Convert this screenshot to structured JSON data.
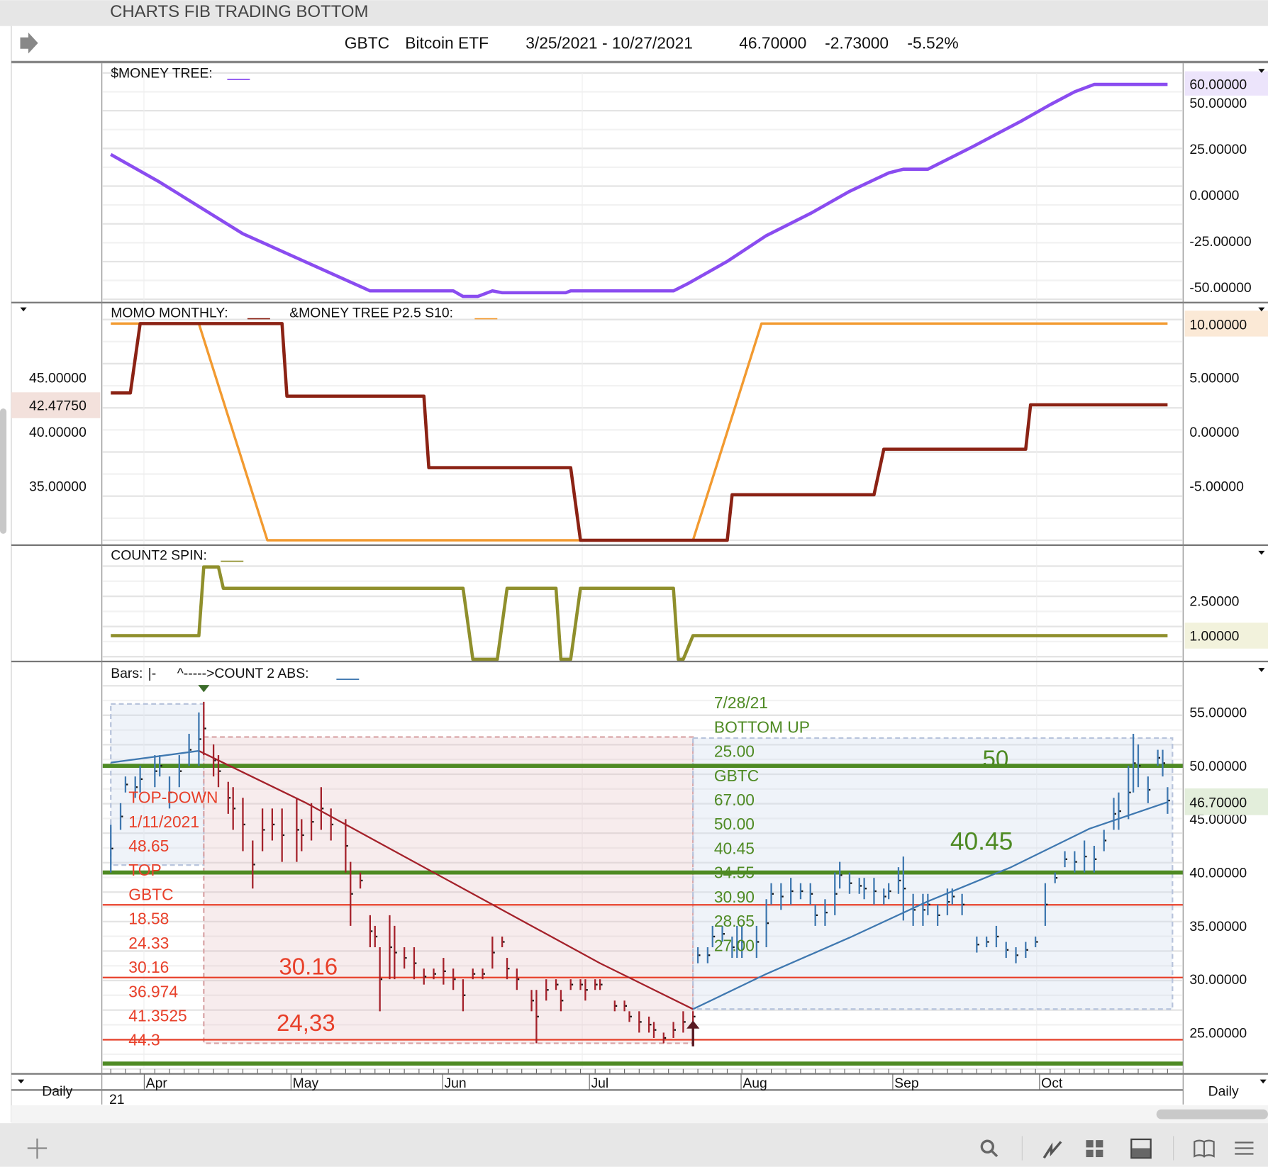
{
  "window_title": "CHARTS FIB TRADING BOTTOM",
  "header": {
    "symbol": "GBTC",
    "name": "Bitcoin ETF",
    "range": "3/25/2021 - 10/27/2021",
    "last": "46.70000",
    "change": "-2.73000",
    "pct": "-5.52%"
  },
  "colors": {
    "purple": "#8a4cf0",
    "momo": "#8b2214",
    "orange": "#f29a30",
    "spin": "#8f8f2c",
    "green_line": "#4e8a23",
    "red_line": "#e8402a",
    "bar_up": "#3f78b0",
    "bar_down": "#a4212a"
  },
  "panels": {
    "money_tree": {
      "label": "$MONEY TREE:",
      "ticks": [
        "50.00000",
        "25.00000",
        "0.00000",
        "-25.00000",
        "-50.00000"
      ],
      "current": "60.00000"
    },
    "momo": {
      "label": "MOMO MONTHLY:",
      "label2": "&MONEY TREE P2.5 S10:",
      "ticks": [
        "5.00000",
        "0.00000",
        "-5.00000"
      ],
      "current": "10.00000",
      "left_ticks": [
        "45.00000",
        "40.00000",
        "35.00000"
      ],
      "left_current": "42.47750"
    },
    "spin": {
      "label": "COUNT2 SPIN:",
      "ticks": [
        "2.50000"
      ],
      "current": "1.00000"
    },
    "price": {
      "label": "Bars:",
      "label_sym": "|-",
      "label2": "^----->COUNT 2 ABS:",
      "ticks": [
        "55.00000",
        "50.00000",
        "45.00000",
        "40.00000",
        "35.00000",
        "30.00000",
        "25.00000"
      ],
      "current": "46.70000"
    }
  },
  "annotations": {
    "left": [
      "TOP-DOWN",
      "1/11/2021",
      "48.65",
      "TOP",
      "GBTC",
      "18.58",
      "24.33",
      "30.16",
      "36.974",
      "41.3525",
      "44.3"
    ],
    "right": [
      "7/28/21",
      "BOTTOM UP",
      "25.00",
      "GBTC",
      "67.00",
      "50.00",
      "40.45",
      "34.55",
      "30.90",
      "28.65",
      "27.00"
    ],
    "big": {
      "a": "30.16",
      "b": "24,33",
      "c": "50",
      "d": "40.45"
    }
  },
  "x_axis": {
    "months": [
      "Apr",
      "May",
      "Jun",
      "Jul",
      "Aug",
      "Sep",
      "Oct"
    ],
    "year": "21",
    "period_left": "Daily",
    "period_right": "Daily"
  },
  "toolbar": {
    "icons": [
      "add-icon",
      "search-icon",
      "chart-line-icon",
      "grid-icon",
      "panel-icon",
      "book-icon",
      "menu-icon"
    ]
  },
  "chart_data": {
    "type": "ohlc",
    "x_unit": "calendar days since 3/25/2021",
    "bars": [
      [
        0,
        44.5,
        40
      ],
      [
        2,
        46.5,
        44
      ],
      [
        3,
        49,
        47.5
      ],
      [
        5,
        49,
        47
      ],
      [
        6,
        50,
        47.5
      ],
      [
        9,
        51,
        48
      ],
      [
        10,
        51,
        49
      ],
      [
        12,
        49,
        46
      ],
      [
        14,
        51,
        48
      ],
      [
        16,
        53,
        50
      ],
      [
        18,
        55,
        50
      ],
      [
        19,
        56,
        51
      ],
      [
        21,
        52,
        49
      ],
      [
        22,
        51,
        48
      ],
      [
        24,
        48.5,
        45.5
      ],
      [
        25,
        48,
        44
      ],
      [
        27,
        47,
        42
      ],
      [
        29,
        43,
        38.5
      ],
      [
        31,
        46,
        42
      ],
      [
        33,
        46,
        43
      ],
      [
        35,
        46,
        41
      ],
      [
        38,
        47,
        41
      ],
      [
        39,
        45,
        42
      ],
      [
        41,
        46.5,
        43
      ],
      [
        43,
        48,
        44
      ],
      [
        45,
        46,
        43
      ],
      [
        48,
        45,
        40
      ],
      [
        49,
        41,
        35
      ],
      [
        51,
        40,
        38.5
      ],
      [
        53,
        36,
        33
      ],
      [
        54,
        35,
        33
      ],
      [
        55,
        33,
        27
      ],
      [
        57,
        36,
        30
      ],
      [
        58,
        35,
        30
      ],
      [
        60,
        33,
        31
      ],
      [
        62,
        33,
        30
      ],
      [
        64,
        31,
        29.5
      ],
      [
        66,
        31,
        30
      ],
      [
        68,
        32,
        29.5
      ],
      [
        70,
        31,
        29
      ],
      [
        72,
        30,
        27
      ],
      [
        74,
        31,
        30
      ],
      [
        76,
        31,
        30
      ],
      [
        78,
        34,
        31
      ],
      [
        80,
        34,
        33
      ],
      [
        81,
        32,
        30
      ],
      [
        83,
        31,
        29
      ],
      [
        86,
        29,
        27
      ],
      [
        87,
        29,
        24
      ],
      [
        89,
        30,
        28
      ],
      [
        91,
        30,
        29
      ],
      [
        92,
        29,
        27
      ],
      [
        94,
        30,
        29
      ],
      [
        96,
        30,
        29
      ],
      [
        97,
        30,
        28
      ],
      [
        99,
        30,
        29
      ],
      [
        100,
        30,
        29
      ],
      [
        103,
        28,
        27
      ],
      [
        105,
        28,
        27
      ],
      [
        106,
        27,
        26
      ],
      [
        108,
        27,
        25
      ],
      [
        110,
        26.5,
        25
      ],
      [
        111,
        26,
        24.5
      ],
      [
        113,
        25,
        24
      ],
      [
        115,
        26,
        24.5
      ],
      [
        117,
        27,
        25
      ],
      [
        119,
        27,
        26
      ],
      [
        120,
        33,
        31.5
      ],
      [
        122,
        33,
        31.5
      ],
      [
        123,
        35,
        33
      ],
      [
        125,
        35,
        33.5
      ],
      [
        127,
        34,
        32
      ],
      [
        128,
        35,
        32
      ],
      [
        129,
        35,
        32
      ],
      [
        132,
        35,
        32
      ],
      [
        134,
        37.5,
        33
      ],
      [
        135,
        39,
        37
      ],
      [
        137,
        39,
        36.5
      ],
      [
        139,
        39.5,
        37
      ],
      [
        141,
        39,
        37.5
      ],
      [
        143,
        39,
        37
      ],
      [
        144,
        37,
        35
      ],
      [
        146,
        37.5,
        35
      ],
      [
        148,
        40,
        36
      ],
      [
        149,
        41,
        38.5
      ],
      [
        151,
        40,
        38
      ],
      [
        153,
        39.5,
        38
      ],
      [
        154,
        39.5,
        37.5
      ],
      [
        156,
        39.5,
        37
      ],
      [
        158,
        38.5,
        37
      ],
      [
        159,
        39,
        37.5
      ],
      [
        161,
        40.5,
        38
      ],
      [
        162,
        41.5,
        35.5
      ],
      [
        164,
        38,
        35
      ],
      [
        166,
        38,
        35
      ],
      [
        167,
        38,
        36
      ],
      [
        169,
        37,
        35
      ],
      [
        171,
        38.5,
        36
      ],
      [
        172,
        38.5,
        37
      ],
      [
        174,
        38,
        36
      ],
      [
        177,
        34,
        32.5
      ],
      [
        179,
        34,
        33
      ],
      [
        181,
        35,
        33
      ],
      [
        183,
        33.5,
        32
      ],
      [
        185,
        33,
        31.5
      ],
      [
        187,
        33.5,
        32
      ],
      [
        189,
        34,
        33
      ],
      [
        191,
        39,
        35
      ],
      [
        193,
        40,
        39
      ],
      [
        195,
        42,
        40.5
      ],
      [
        197,
        42,
        40
      ],
      [
        199,
        43,
        40
      ],
      [
        201,
        42.5,
        40
      ],
      [
        203,
        44,
        42
      ],
      [
        205,
        47,
        44
      ],
      [
        206,
        47.5,
        44
      ],
      [
        208,
        50,
        45
      ],
      [
        209,
        53,
        47.5
      ],
      [
        210,
        52,
        48
      ],
      [
        212,
        49,
        46.5
      ],
      [
        214,
        51.5,
        50
      ],
      [
        215,
        51.5,
        49
      ],
      [
        216,
        48,
        45.5
      ]
    ],
    "moving_average": [
      [
        0,
        50.3
      ],
      [
        18,
        51.4
      ],
      [
        40,
        46.5
      ],
      [
        60,
        41.5
      ],
      [
        80,
        36.5
      ],
      [
        100,
        31.5
      ],
      [
        119,
        27.2
      ],
      [
        134,
        30.5
      ],
      [
        151,
        33.9
      ],
      [
        167,
        37.3
      ],
      [
        184,
        40.5
      ],
      [
        200,
        44.1
      ],
      [
        216,
        46.6
      ]
    ],
    "money_tree": [
      [
        0,
        22
      ],
      [
        10,
        7
      ],
      [
        27,
        -21
      ],
      [
        53,
        -52
      ],
      [
        70,
        -52
      ],
      [
        72,
        -55
      ],
      [
        75,
        -55
      ],
      [
        78,
        -52
      ],
      [
        80,
        -53
      ],
      [
        93,
        -53
      ],
      [
        94,
        -52
      ],
      [
        115,
        -52
      ],
      [
        118,
        -48
      ],
      [
        126,
        -36
      ],
      [
        134,
        -22
      ],
      [
        143,
        -10
      ],
      [
        151,
        2
      ],
      [
        159,
        12
      ],
      [
        162,
        14
      ],
      [
        167,
        14
      ],
      [
        176,
        26
      ],
      [
        181,
        33
      ],
      [
        186,
        40
      ],
      [
        192,
        49
      ],
      [
        197,
        56
      ],
      [
        201,
        60
      ],
      [
        216,
        60
      ]
    ],
    "momo_monthly": [
      [
        0,
        3.6
      ],
      [
        4,
        3.6
      ],
      [
        6,
        10
      ],
      [
        35,
        10
      ],
      [
        36,
        3.3
      ],
      [
        64,
        3.3
      ],
      [
        65,
        -3.3
      ],
      [
        94,
        -3.3
      ],
      [
        96,
        -10
      ],
      [
        126,
        -10
      ],
      [
        127,
        -5.8
      ],
      [
        156,
        -5.8
      ],
      [
        158,
        -1.6
      ],
      [
        187,
        -1.6
      ],
      [
        188,
        2.5
      ],
      [
        216,
        2.5
      ]
    ],
    "money_tree_p25": [
      [
        0,
        10
      ],
      [
        18,
        10
      ],
      [
        32,
        -10
      ],
      [
        119,
        -10
      ],
      [
        133,
        10
      ],
      [
        216,
        10
      ]
    ],
    "count2_spin": [
      [
        0,
        1
      ],
      [
        18,
        1
      ],
      [
        19,
        3.9
      ],
      [
        22,
        3.9
      ],
      [
        23,
        3
      ],
      [
        72,
        3
      ],
      [
        74,
        0
      ],
      [
        79,
        0
      ],
      [
        81,
        3
      ],
      [
        91,
        3
      ],
      [
        92,
        0
      ],
      [
        94,
        0
      ],
      [
        96,
        3
      ],
      [
        115,
        3
      ],
      [
        116,
        0
      ],
      [
        117,
        0
      ],
      [
        119,
        1
      ],
      [
        216,
        1
      ]
    ],
    "hlines": {
      "green": [
        50,
        40,
        22.1
      ],
      "red": [
        36.974,
        30.16,
        24.33
      ]
    },
    "zones": [
      {
        "from": 0,
        "to": 19,
        "hi": 55.8,
        "lo": 40.7,
        "kind": "up"
      },
      {
        "from": 19,
        "to": 119,
        "hi": 52.7,
        "lo": 24.0,
        "kind": "down"
      },
      {
        "from": 119,
        "to": 217,
        "hi": 52.6,
        "lo": 27.2,
        "kind": "up"
      }
    ],
    "ylim_price": [
      21,
      57
    ]
  }
}
